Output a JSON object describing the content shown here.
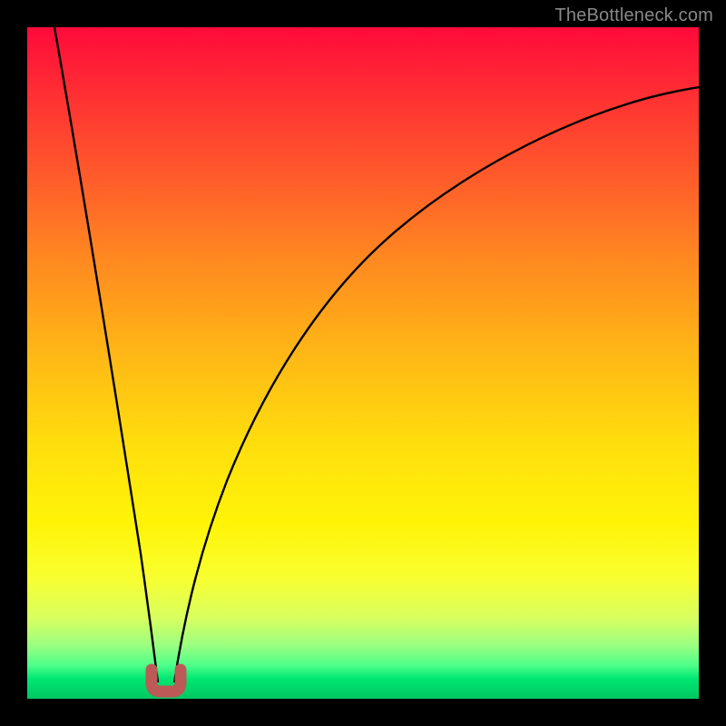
{
  "watermark": "TheBottleneck.com",
  "colors": {
    "frame": "#000000",
    "curve_stroke": "#000000",
    "foot_fill": "#bb5a56",
    "foot_stroke": "#bb5a56",
    "gradient_top": "#ff0a3a",
    "gradient_bottom": "#00c762"
  },
  "chart_data": {
    "type": "line",
    "title": "",
    "xlabel": "",
    "ylabel": "",
    "xlim": [
      0,
      100
    ],
    "ylim": [
      0,
      100
    ],
    "series": [
      {
        "name": "left-branch",
        "x": [
          4,
          6,
          8,
          10,
          12,
          14,
          16,
          18,
          19
        ],
        "y": [
          100,
          88,
          76,
          63,
          50,
          37,
          24,
          10,
          3
        ]
      },
      {
        "name": "right-branch",
        "x": [
          22,
          24,
          27,
          30,
          35,
          40,
          47,
          55,
          65,
          78,
          90,
          100
        ],
        "y": [
          3,
          11,
          22,
          32,
          45,
          54,
          63,
          71,
          78,
          84,
          88,
          91
        ]
      }
    ],
    "minimum_marker": {
      "x_range": [
        18.2,
        22.4
      ],
      "y": 2.2,
      "shape": "U"
    },
    "grid": false,
    "legend": false
  }
}
